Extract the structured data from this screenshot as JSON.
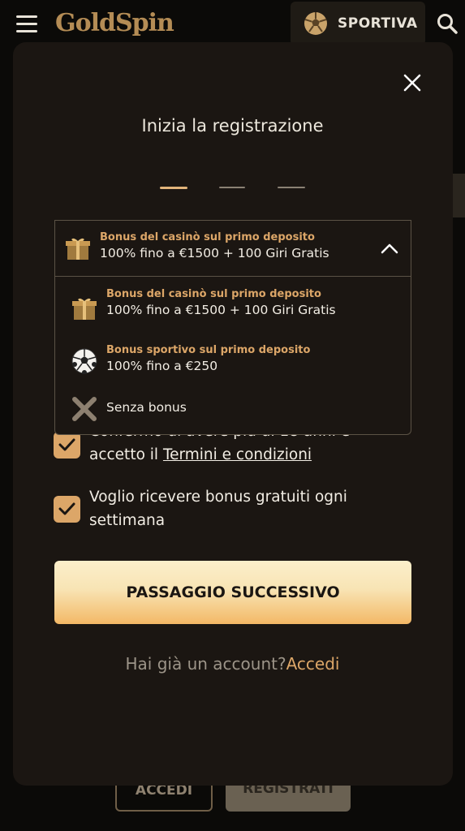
{
  "header": {
    "logo_text": "GoldSpin",
    "sport_label": "SPORTIVA"
  },
  "background": {
    "accedi_label": "ACCEDI",
    "registrati_label": "REGISTRATI"
  },
  "modal": {
    "title": "Inizia la registrazione",
    "steps": {
      "current": 1,
      "total": 3
    }
  },
  "bonus_select": {
    "selected_category": "Bonus del casinò sul primo deposito",
    "selected_value": "100% fino a €1500 + 100 Giri Gratis",
    "options": [
      {
        "category": "Bonus del casinò sul primo deposito",
        "value": "100% fino a €1500 + 100 Giri Gratis",
        "icon": "gift-icon"
      },
      {
        "category": "Bonus sportivo sul primo deposito",
        "value": "100% fino a €250",
        "icon": "soccer-ball-icon"
      },
      {
        "category": "",
        "value": "Senza bonus",
        "icon": "cross-icon"
      }
    ]
  },
  "checkboxes": {
    "terms_line1": "Confermo di avere più di 18 anni e",
    "terms_prefix": "accetto il ",
    "terms_link": "Termini e condizioni",
    "newsletter_line1": "Voglio ricevere bonus gratuiti ogni",
    "newsletter_line2": "settimana"
  },
  "next_button_label": "PASSAGGIO SUCCESSIVO",
  "account": {
    "question": "Hai già un account?",
    "link": "Accedi"
  },
  "colors": {
    "accent": "#dca668",
    "modal_bg": "#1b1612",
    "page_bg": "#0b0a08"
  }
}
